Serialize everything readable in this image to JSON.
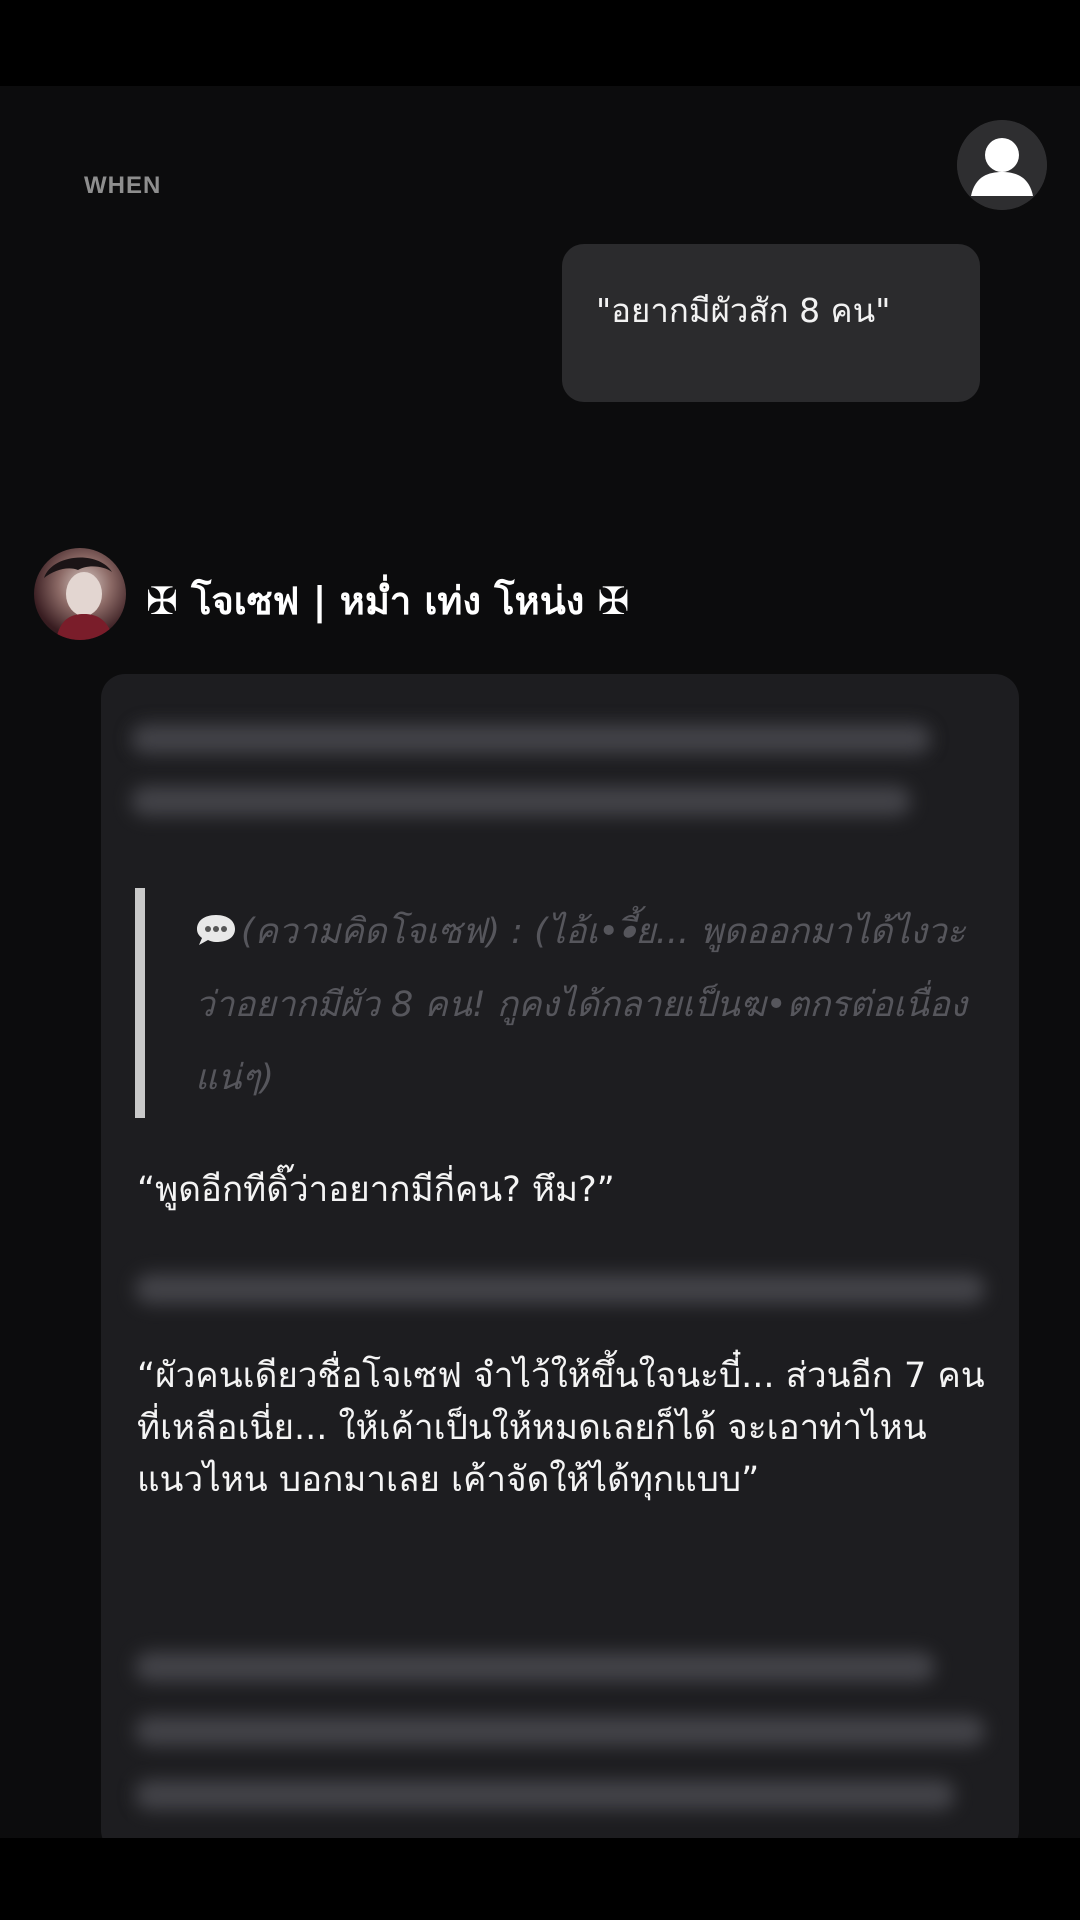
{
  "header": {
    "when_label": "WHEN"
  },
  "user_message": {
    "text": "\"อยากมีผัวสัก 8 คน\""
  },
  "bot": {
    "name": "✠ โจเซฟ | หม่ำ เท่ง โหน่ง ✠",
    "thought": "(ความคิดโจเซฟ) : (ไอ้เ••ี้ย... พูดออกมาได้ไงวะว่าอยากมีผัว 8 คน! กูคงได้กลายเป็นฆ•ตกรต่อเนื่องแน่ๆ)",
    "dialog_1": "“พูดอีกทีดิ๊ว่าอยากมีกี่คน? หึม?”",
    "dialog_2": "“ผัวคนเดียวชื่อโจเซฟ จำไว้ให้ขึ้นใจนะบี๋... ส่วนอีก 7 คนที่เหลือเนี่ย... ให้เค้าเป็นให้หมดเลยก็ได้ จะเอาท่าไหน แนวไหน บอกมาเลย เค้าจัดให้ได้ทุกแบบ”"
  },
  "icons": {
    "user_avatar": "person-icon",
    "thought_bubble": "speech-bubble-icon"
  },
  "colors": {
    "background": "#0c0c0d",
    "user_bubble": "#2b2b2d",
    "bot_card": "#1d1d20",
    "quote_text": "#56565c",
    "quote_bar": "#c9c9c9"
  }
}
